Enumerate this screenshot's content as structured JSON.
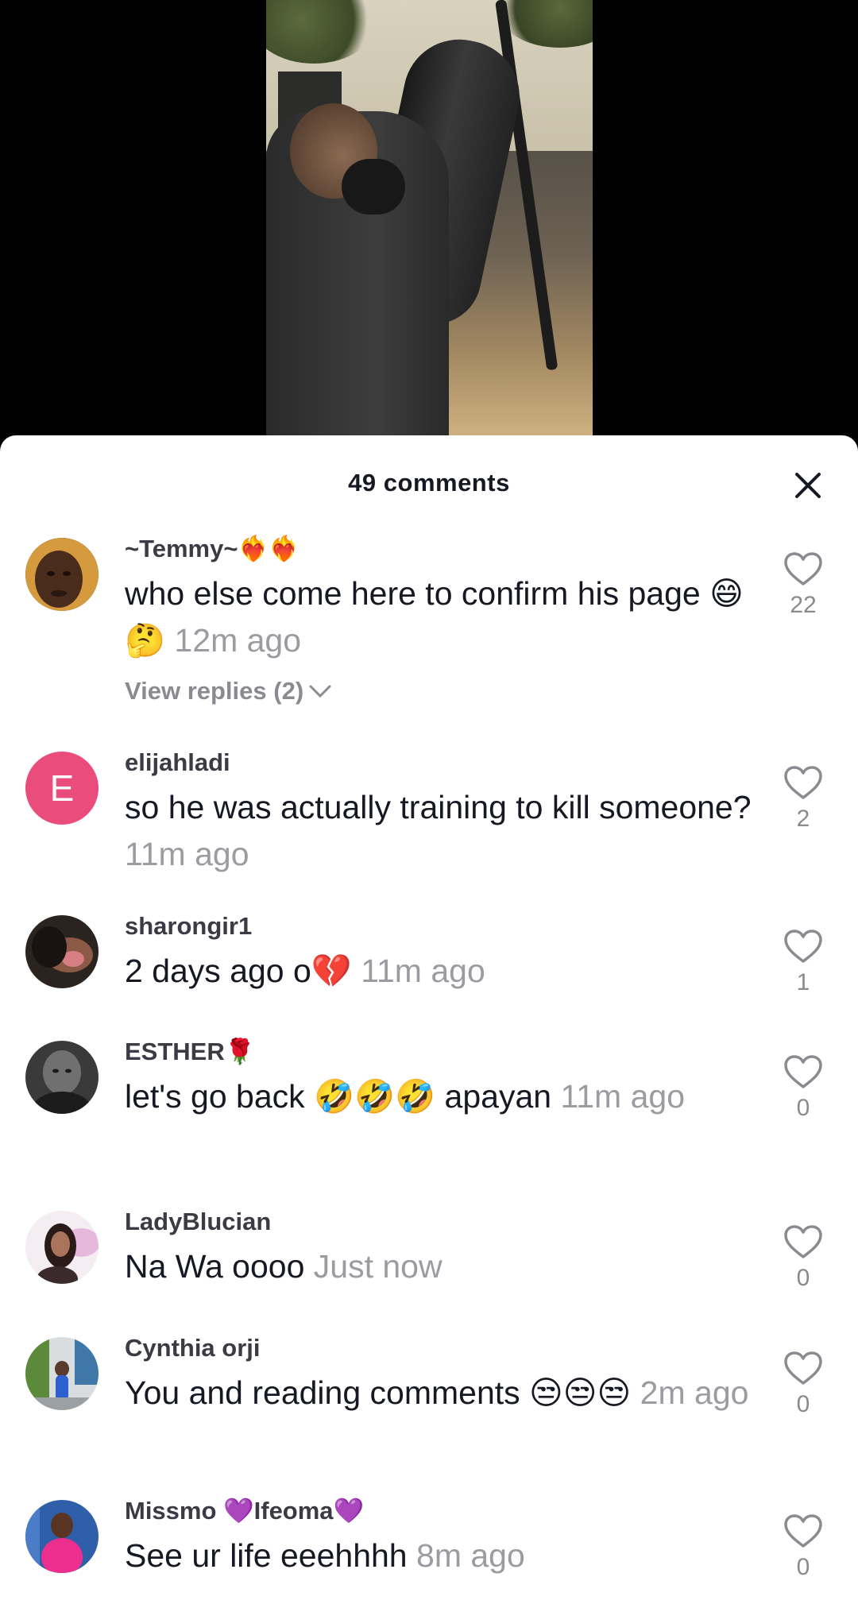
{
  "sheet": {
    "title": "49 comments"
  },
  "comments": [
    {
      "username": "~Temmy~❤️‍🔥❤️‍🔥",
      "text": "who else come here to confirm his page 😄🤔",
      "time": "12m ago",
      "likes": "22",
      "replies": "View replies (2)",
      "avatar": "photo"
    },
    {
      "username": "elijahladi",
      "text": "so he was actually training to kill someone?",
      "time": "11m ago",
      "likes": "2",
      "avatar_letter": "E",
      "avatar_color": "#ea4d7c"
    },
    {
      "username": "sharongir1",
      "text": "2 days ago o💔",
      "time": "11m ago",
      "likes": "1",
      "avatar": "photo"
    },
    {
      "username": "ESTHER🌹",
      "text": "let's go back 🤣🤣🤣 apayan",
      "time": "11m ago",
      "likes": "0",
      "avatar": "photo"
    },
    {
      "username": "LadyBlucian",
      "text": "Na Wa oooo",
      "time": "Just now",
      "likes": "0",
      "avatar": "photo"
    },
    {
      "username": "Cynthia orji",
      "text": "You and reading comments 😒😒😒",
      "time": "2m ago",
      "likes": "0",
      "avatar": "photo"
    },
    {
      "username": "Missmo 💜Ifeoma💜",
      "text": "See ur life eeehhhh",
      "time": "8m ago",
      "likes": "0",
      "avatar": "photo"
    }
  ]
}
